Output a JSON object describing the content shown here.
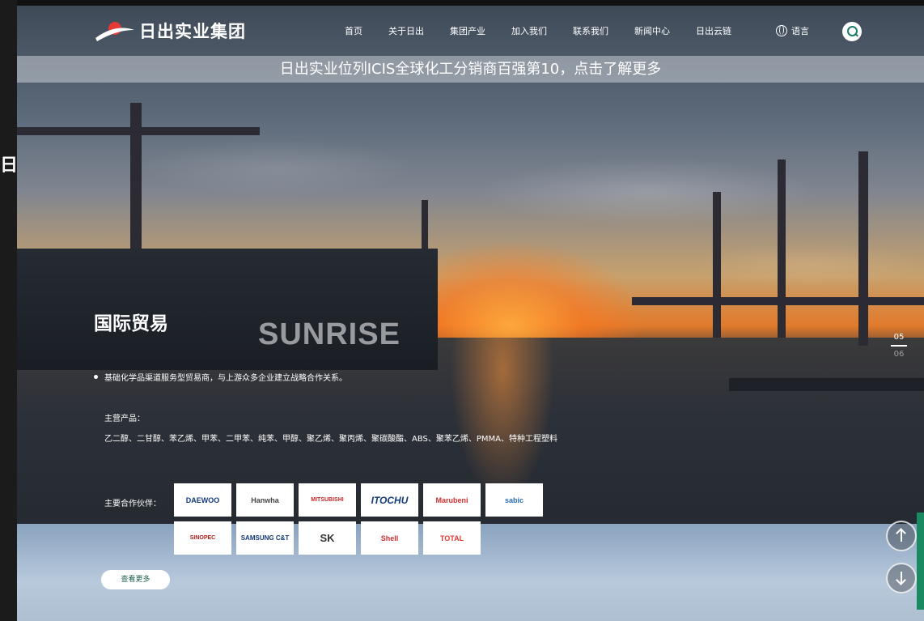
{
  "sidebar_strip": {
    "glyph": "日"
  },
  "header": {
    "logo_text": "日出实业集团",
    "nav": [
      "首页",
      "关于日出",
      "集团产业",
      "加入我们",
      "联系我们",
      "新闻中心",
      "日出云链"
    ],
    "language_label": "语言"
  },
  "banner": {
    "text": "日出实业位列ICIS全球化工分销商百强第10，点击了解更多"
  },
  "hero": {
    "ship_name": "SUNRISE",
    "title": "国际贸易",
    "description": "基础化学品渠道服务型贸易商，与上游众多企业建立战略合作关系。",
    "products_label": "主营产品：",
    "products": "乙二醇、二甘醇、苯乙烯、甲苯、二甲苯、纯苯、甲醇、聚乙烯、聚丙烯、聚碳酸酯、ABS、聚苯乙烯、PMMA、特种工程塑料",
    "partners_label": "主要合作伙伴：",
    "partners": [
      "DAEWOO",
      "Hanwha",
      "MITSUBISHI",
      "ITOCHU",
      "Marubeni",
      "sabic",
      "SINOPEC",
      "SAMSUNG C&T",
      "SK",
      "Shell",
      "TOTAL"
    ],
    "more_button": "查看更多"
  },
  "pager": {
    "current": "05",
    "next": "06"
  },
  "colors": {
    "accent": "#1c7c6a",
    "side_tab": "#1a8a63"
  },
  "icons": {
    "search": "search-icon",
    "language": "globe-icon",
    "scroll_up": "arrow-up-icon",
    "scroll_down": "arrow-down-icon"
  }
}
